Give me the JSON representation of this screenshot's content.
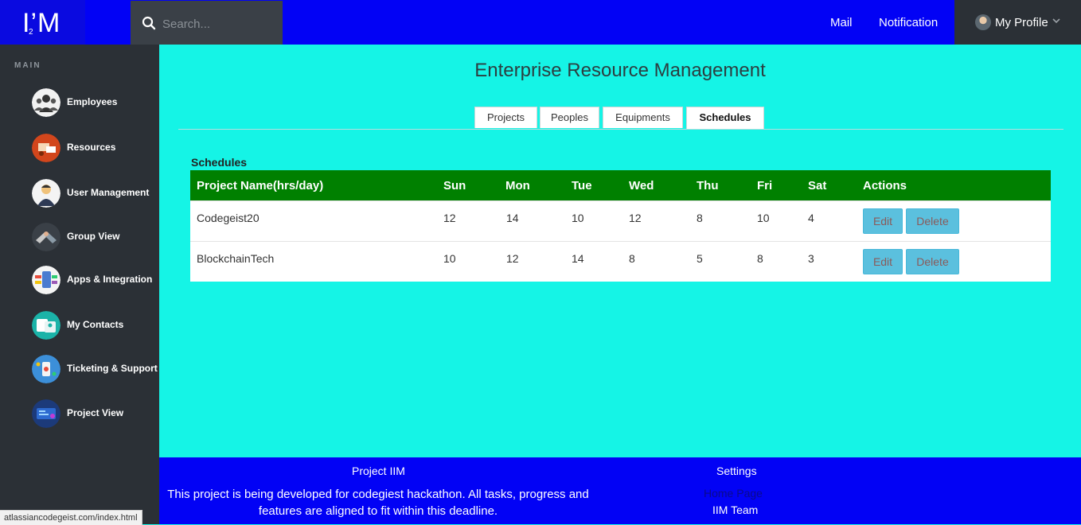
{
  "brand": {
    "logo": "I’M",
    "logo_sub": "2"
  },
  "search": {
    "placeholder": "Search..."
  },
  "topnav": {
    "mail": "Mail",
    "notification": "Notification",
    "profile": "My Profile"
  },
  "sidebar": {
    "section": "MAIN",
    "items": [
      {
        "label": "Employees",
        "icon": "employees-icon"
      },
      {
        "label": "Resources",
        "icon": "resources-icon"
      },
      {
        "label": "User Management",
        "icon": "user-management-icon"
      },
      {
        "label": "Group View",
        "icon": "group-view-icon"
      },
      {
        "label": "Apps & Integration",
        "icon": "apps-integration-icon"
      },
      {
        "label": "My Contacts",
        "icon": "my-contacts-icon"
      },
      {
        "label": "Ticketing & Support",
        "icon": "ticketing-support-icon"
      },
      {
        "label": "Project View",
        "icon": "project-view-icon"
      }
    ]
  },
  "main": {
    "title": "Enterprise Resource Management",
    "tabs": [
      {
        "label": "Projects",
        "active": false
      },
      {
        "label": "Peoples",
        "active": false
      },
      {
        "label": "Equipments",
        "active": false
      },
      {
        "label": "Schedules",
        "active": true
      }
    ],
    "section_label": "Schedules",
    "table": {
      "headers": [
        "Project Name(hrs/day)",
        "Sun",
        "Mon",
        "Tue",
        "Wed",
        "Thu",
        "Fri",
        "Sat",
        "Actions"
      ],
      "rows": [
        {
          "name": "Codegeist20",
          "hours": [
            "12",
            "14",
            "10",
            "12",
            "8",
            "10",
            "4"
          ]
        },
        {
          "name": "BlockchainTech",
          "hours": [
            "10",
            "12",
            "14",
            "8",
            "5",
            "8",
            "3"
          ]
        }
      ],
      "edit_label": "Edit",
      "delete_label": "Delete"
    }
  },
  "footer": {
    "title1": "Project IIM",
    "text_line1": "This project is being developed for codegiest hackathon. All tasks, progress and",
    "text_line2": "features are aligned to fit within this deadline.",
    "title2": "Settings",
    "link1": "Home Page",
    "link2": "IIM Team"
  },
  "status_url": "atlassiancodegeist.com/index.html",
  "colors": {
    "topbar": "#0202f5",
    "sidebar": "#2b3036",
    "content": "#15f4e6",
    "table_header": "#008000",
    "action_button": "#5bc0de"
  }
}
